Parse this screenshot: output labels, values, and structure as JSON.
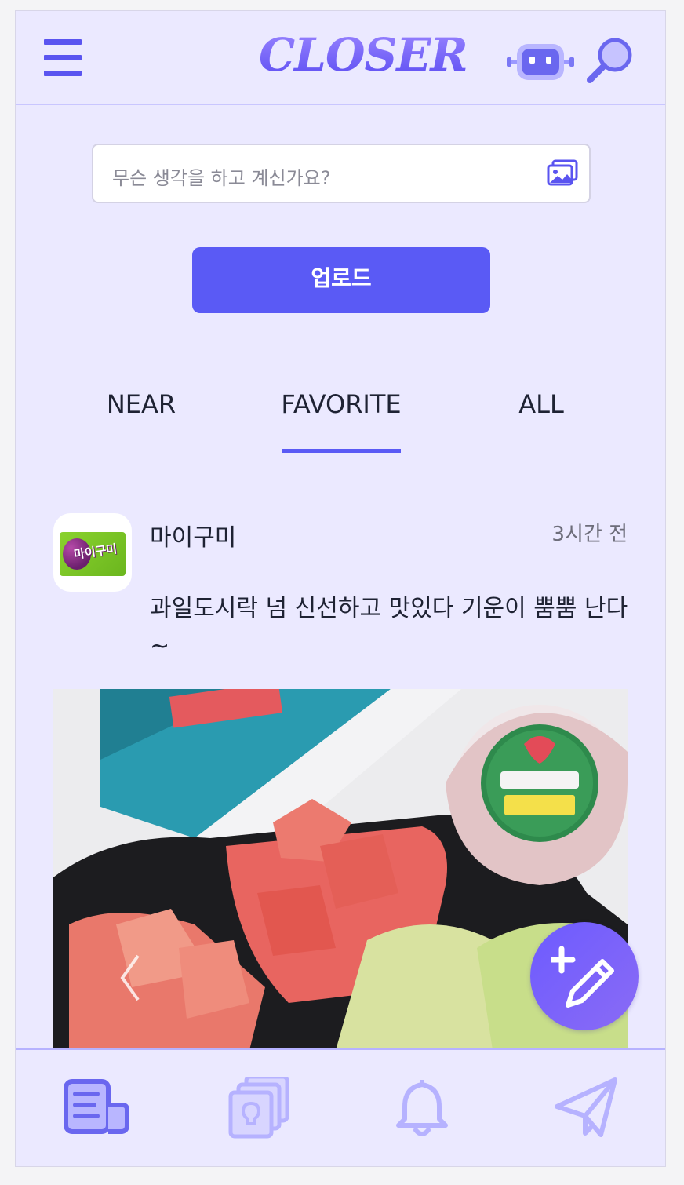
{
  "header": {
    "logo": "CLOSER",
    "menu_icon": "hamburger-menu-icon",
    "robot_icon": "robot-icon",
    "search_icon": "search-icon"
  },
  "compose": {
    "placeholder": "무슨 생각을 하고 계신가요?",
    "gallery_icon": "image-gallery-icon"
  },
  "upload_label": "업로드",
  "tabs": [
    {
      "label": "NEAR",
      "active": false
    },
    {
      "label": "FAVORITE",
      "active": true
    },
    {
      "label": "ALL",
      "active": false
    }
  ],
  "post": {
    "username": "마이구미",
    "time": "3시간 전",
    "text": "과일도시락 넘 신선하고 맛있다 기운이 뿜뿜 난다~",
    "avatar_label": "마이구미"
  },
  "colors": {
    "accent": "#5a5af5",
    "background": "#ebe9ff",
    "nav_icon": "#b6b2ff"
  },
  "bottom_nav": [
    {
      "icon": "feed-icon",
      "active": true
    },
    {
      "icon": "cards-idea-icon",
      "active": false
    },
    {
      "icon": "bell-icon",
      "active": false
    },
    {
      "icon": "send-icon",
      "active": false
    }
  ],
  "fab_icon": "add-edit-icon"
}
